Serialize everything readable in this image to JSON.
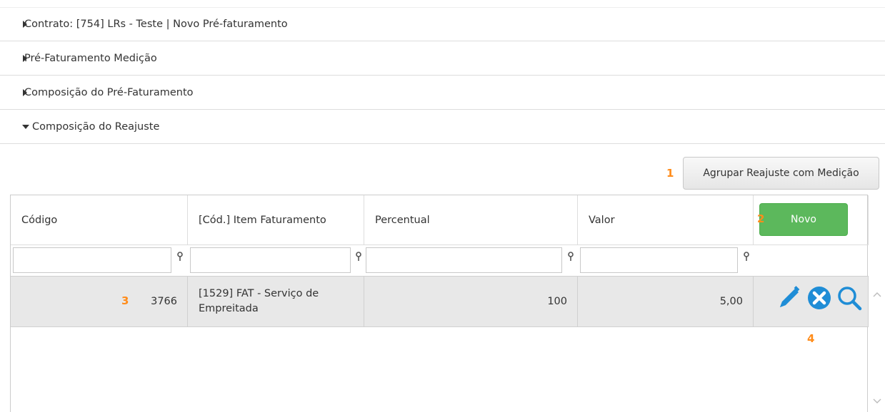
{
  "accordion": {
    "items": [
      {
        "label": "Contrato: [754] LRs - Teste | Novo Pré-faturamento",
        "expanded": false
      },
      {
        "label": "Pré-Faturamento Medição",
        "expanded": false
      },
      {
        "label": "Composição do Pré-Faturamento",
        "expanded": false
      },
      {
        "label": "Composição do Reajuste",
        "expanded": true
      }
    ]
  },
  "annotations": {
    "n1": "1",
    "n2": "2",
    "n3": "3",
    "n4": "4"
  },
  "toolbar": {
    "agrupar_label": "Agrupar Reajuste com Medição",
    "novo_label": "Novo"
  },
  "grid": {
    "columns": [
      "Código",
      "[Cód.] Item Faturamento",
      "Percentual",
      "Valor"
    ],
    "filters": [
      "",
      "",
      "",
      ""
    ],
    "rows": [
      {
        "codigo": "3766",
        "item": "[1529] FAT - Serviço de Empreitada",
        "percentual": "100",
        "valor": "5,00"
      }
    ],
    "row_actions": [
      "pencil-icon",
      "close-circle-icon",
      "search-icon"
    ]
  },
  "colors": {
    "accent_blue": "#1f8dd6",
    "success_green": "#5cb85c",
    "annotation_orange": "#ff8c1a",
    "row_bg": "#e8e8e8"
  }
}
